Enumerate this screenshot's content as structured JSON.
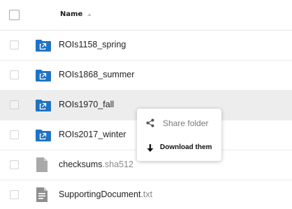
{
  "header": {
    "name_label": "Name"
  },
  "rows": [
    {
      "name": "ROIs1158_spring",
      "ext": "",
      "type": "shared-folder"
    },
    {
      "name": "ROIs1868_summer",
      "ext": "",
      "type": "shared-folder"
    },
    {
      "name": "ROIs1970_fall",
      "ext": "",
      "type": "shared-folder",
      "hovered": true
    },
    {
      "name": "ROIs2017_winter",
      "ext": "",
      "type": "shared-folder"
    },
    {
      "name": "checksums",
      "ext": ".sha512",
      "type": "file"
    },
    {
      "name": "SupportingDocument",
      "ext": ".txt",
      "type": "text-file"
    }
  ],
  "context_menu": {
    "share_label": "Share folder",
    "download_label": "Download them"
  },
  "colors": {
    "folder_blue": "#1f73c4",
    "hover_row": "#ededed",
    "file_gray": "#a9a9a9"
  }
}
